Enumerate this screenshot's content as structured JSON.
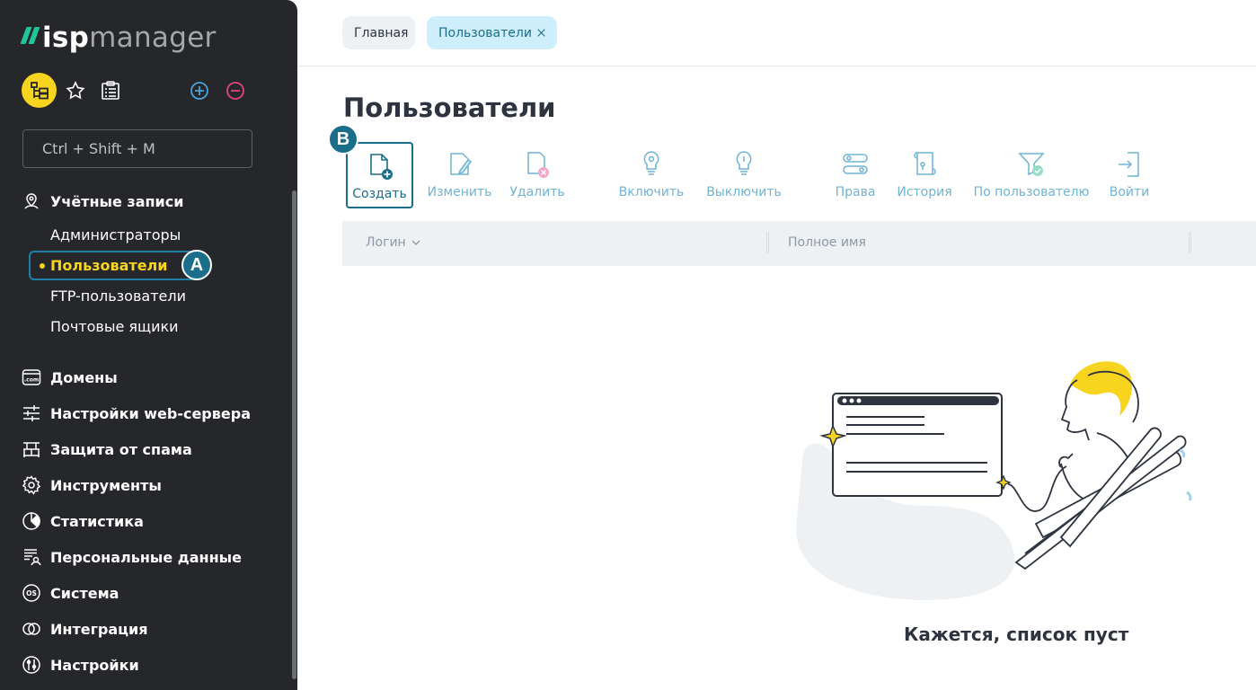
{
  "app": {
    "brand_prefix": "isp",
    "brand_suffix": "manager"
  },
  "sidebar": {
    "search_placeholder": "Ctrl + Shift + M",
    "sections": [
      {
        "label": "Учётные записи",
        "icon": "user-pin-icon"
      },
      {
        "label": "Домены",
        "icon": "dotcom-icon"
      },
      {
        "label": "Настройки web-сервера",
        "icon": "sliders-icon"
      },
      {
        "label": "Защита от спама",
        "icon": "firewall-icon"
      },
      {
        "label": "Инструменты",
        "icon": "gear-icon"
      },
      {
        "label": "Статистика",
        "icon": "pie-chart-icon"
      },
      {
        "label": "Персональные данные",
        "icon": "personal-data-icon"
      },
      {
        "label": "Система",
        "icon": "os-icon"
      },
      {
        "label": "Интеграция",
        "icon": "rings-icon"
      },
      {
        "label": "Настройки",
        "icon": "settings-icon"
      }
    ],
    "accounts_items": [
      "Администраторы",
      "Пользователи",
      "FTP-пользователи",
      "Почтовые ящики"
    ],
    "active_item": "Пользователи",
    "badge_a": "A"
  },
  "tabs": [
    {
      "label": "Главная"
    },
    {
      "label": "Пользователи"
    }
  ],
  "page": {
    "title": "Пользователи",
    "badge_b": "B",
    "empty_message": "Кажется, список пуст"
  },
  "toolbar": [
    {
      "label": "Создать",
      "icon": "file-plus-icon"
    },
    {
      "label": "Изменить",
      "icon": "file-edit-icon"
    },
    {
      "label": "Удалить",
      "icon": "file-delete-icon"
    },
    {
      "label": "Включить",
      "icon": "bulb-on-icon"
    },
    {
      "label": "Выключить",
      "icon": "bulb-off-icon"
    },
    {
      "label": "Права",
      "icon": "permissions-icon"
    },
    {
      "label": "История",
      "icon": "history-icon"
    },
    {
      "label": "По пользователю",
      "icon": "filter-icon"
    },
    {
      "label": "Войти",
      "icon": "login-icon"
    }
  ],
  "table": {
    "columns": [
      "Логин",
      "Полное имя"
    ]
  },
  "colors": {
    "sidebar_bg": "#25272b",
    "accent_yellow": "#f7d51f",
    "accent_teal": "#1a6e8a",
    "tool_disabled": "#6fb4d3"
  }
}
